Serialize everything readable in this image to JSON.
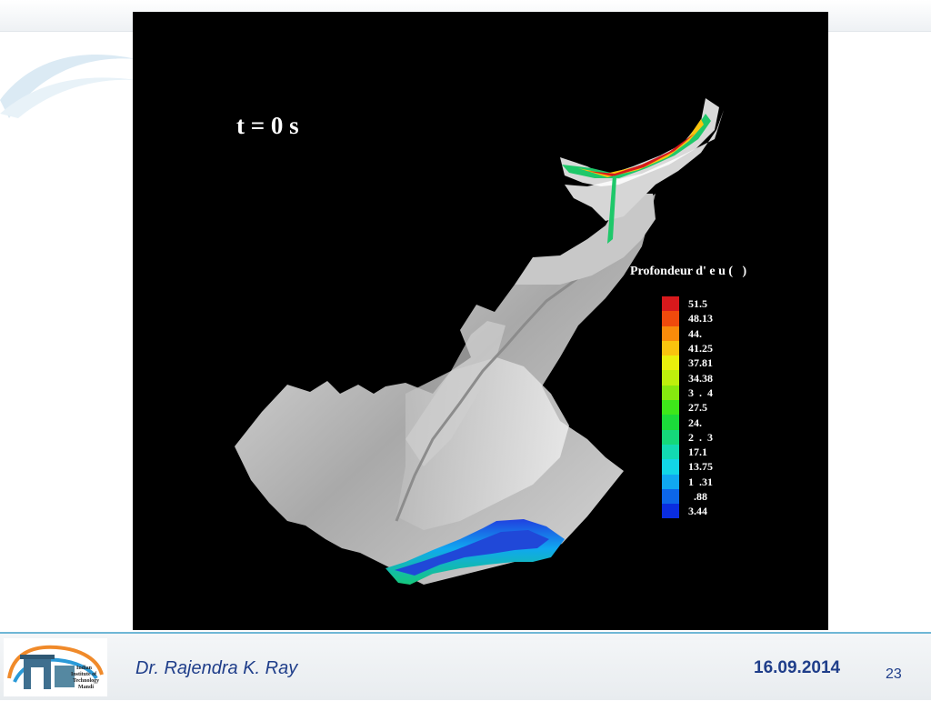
{
  "slide": {
    "time_label": "t = 0 s",
    "legend_title": "Profondeur d' e u (   )",
    "legend_entries": [
      {
        "value": "51.5",
        "color": "#d7191c"
      },
      {
        "value": "48.13",
        "color": "#f04a0c"
      },
      {
        "value": "44.",
        "color": "#f98b0a"
      },
      {
        "value": "41.25",
        "color": "#f9c40e"
      },
      {
        "value": "37.81",
        "color": "#eaf00c"
      },
      {
        "value": "34.38",
        "color": "#bdf00c"
      },
      {
        "value": "3  .  4",
        "color": "#86e80f"
      },
      {
        "value": "27.5",
        "color": "#3ee61a"
      },
      {
        "value": "24.",
        "color": "#1bdb3a"
      },
      {
        "value": "2  .  3",
        "color": "#15d77a"
      },
      {
        "value": "17.1",
        "color": "#12d9b2"
      },
      {
        "value": "13.75",
        "color": "#12d6e6"
      },
      {
        "value": "1  .31",
        "color": "#10a8f0"
      },
      {
        "value": "  .88",
        "color": "#0c66e8"
      },
      {
        "value": "3.44",
        "color": "#0a2de0"
      }
    ]
  },
  "footer": {
    "logo_lines": [
      "Indian",
      "Institute of",
      "Technology",
      "Mandi"
    ],
    "author": "Dr. Rajendra K. Ray",
    "date": "16.09.2014",
    "page_number": "23"
  }
}
